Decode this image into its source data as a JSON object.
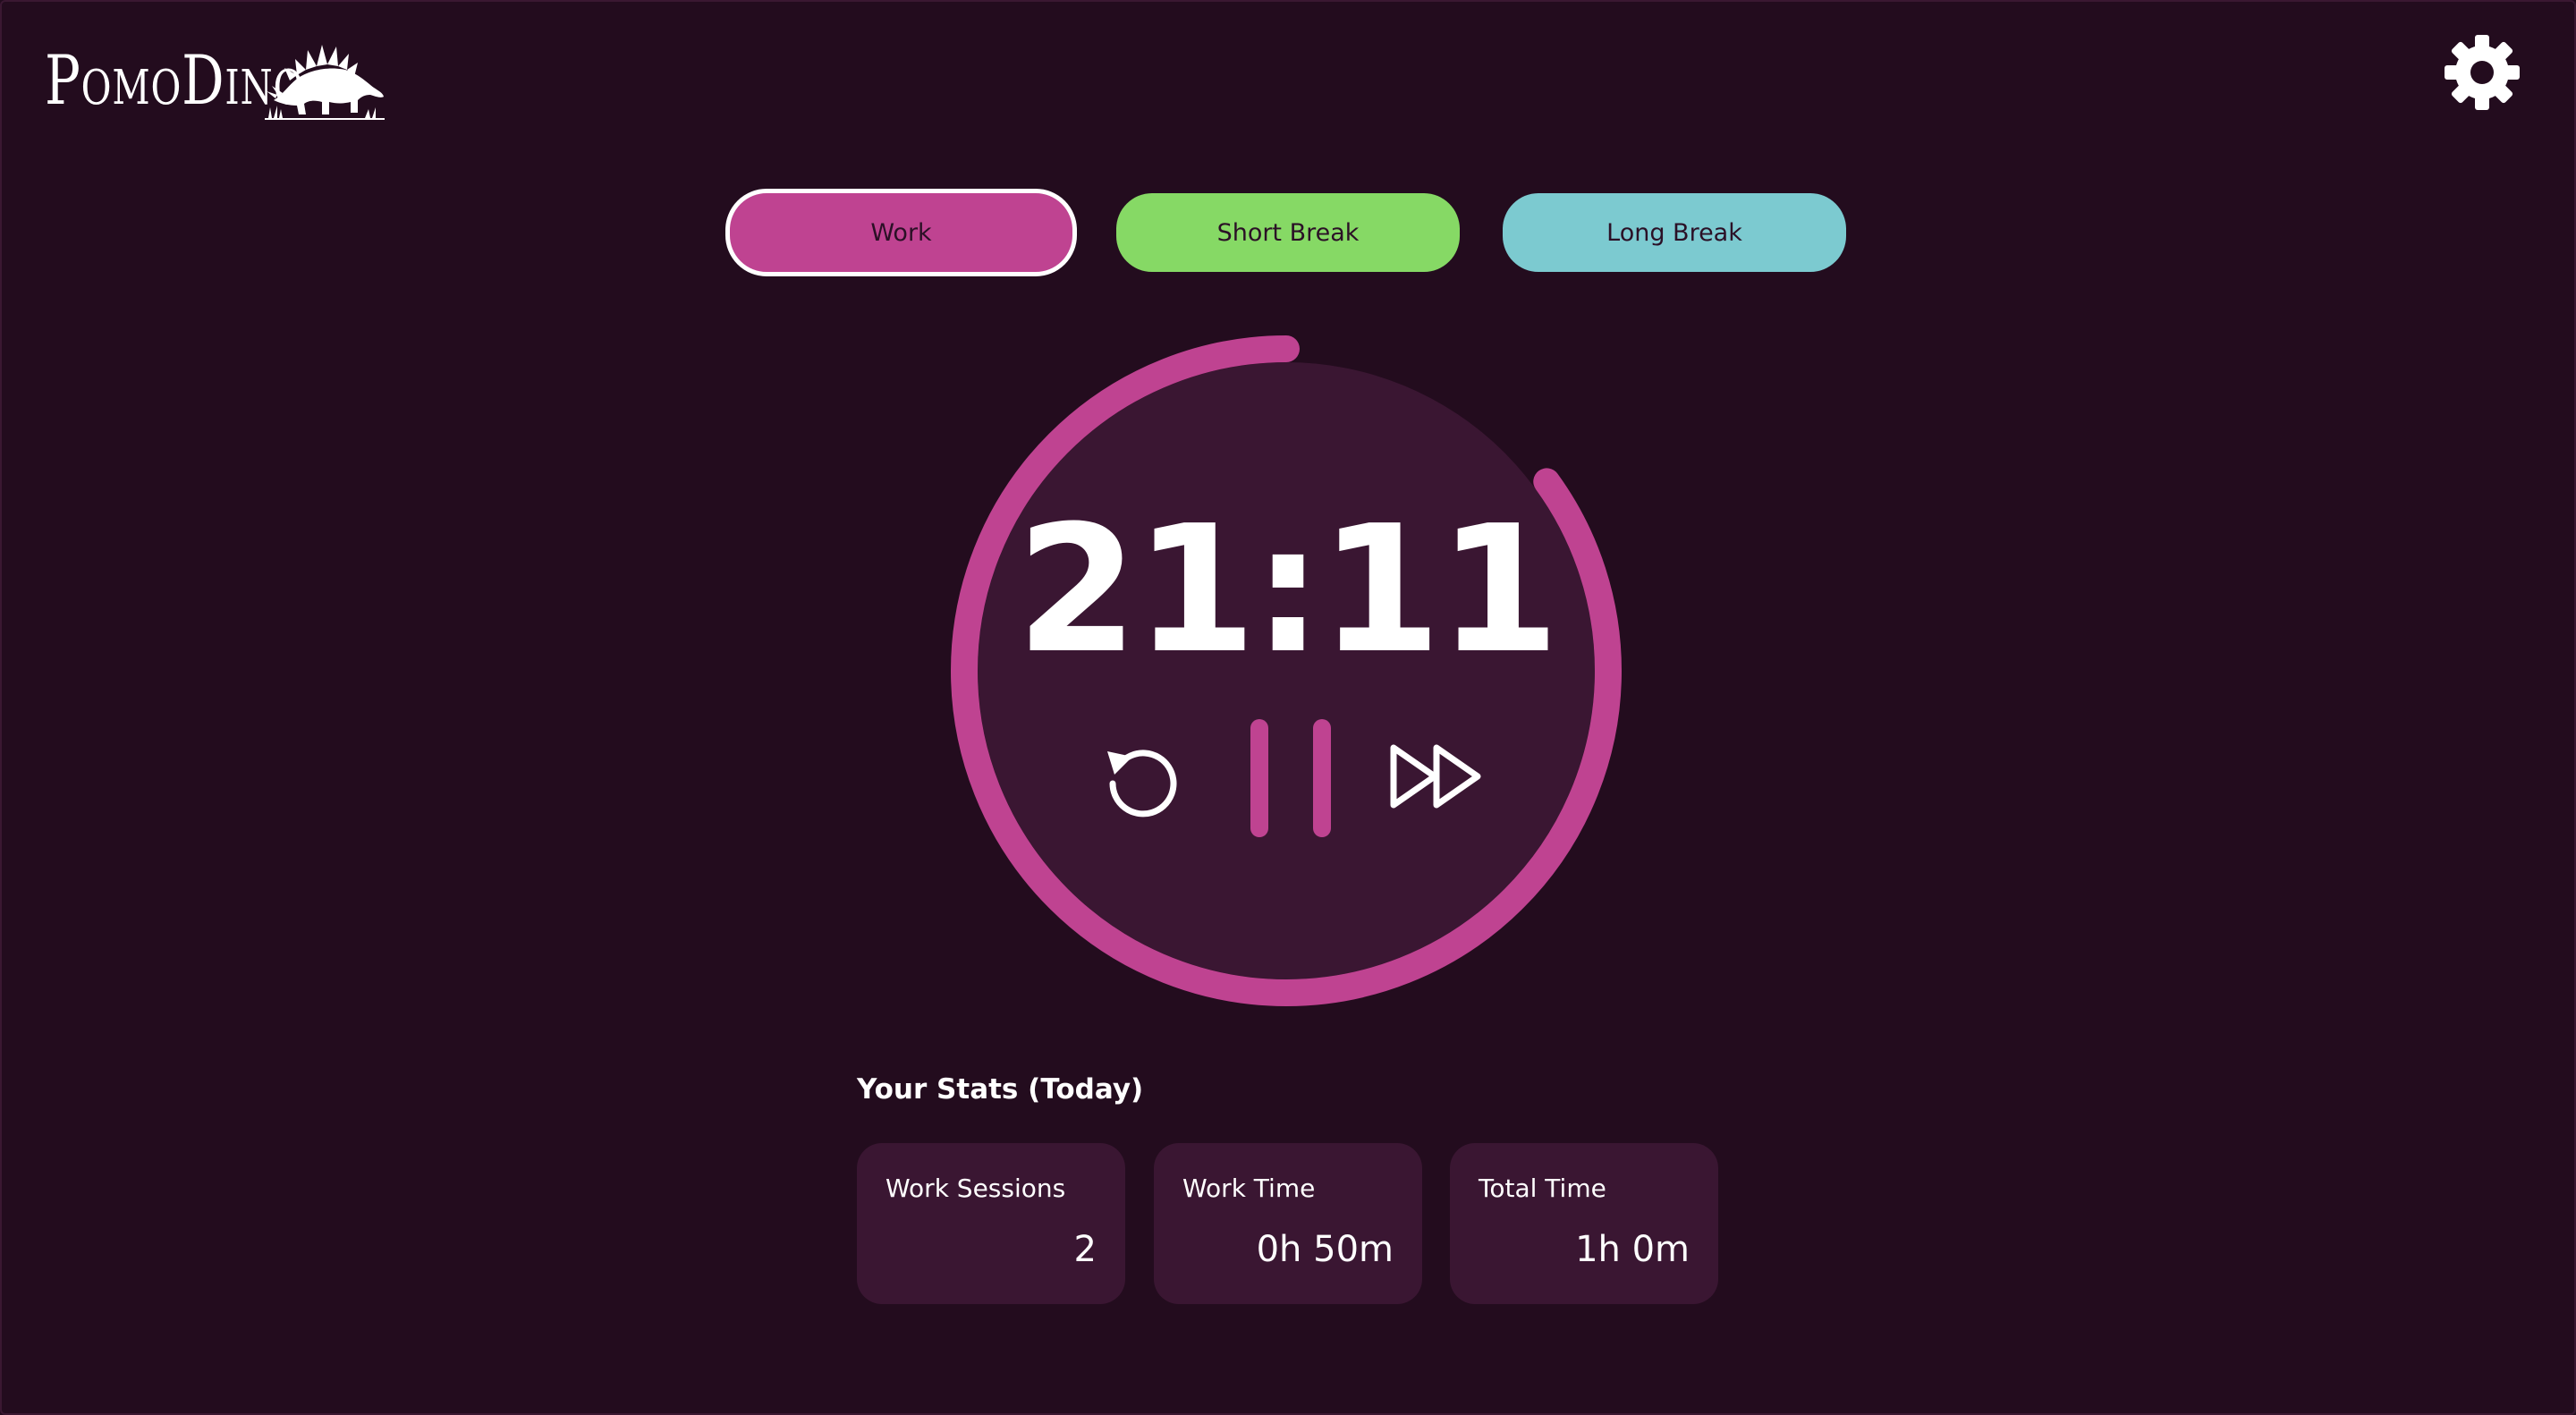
{
  "app": {
    "name": "PomoDino"
  },
  "modes": {
    "work": "Work",
    "short_break": "Short Break",
    "long_break": "Long Break",
    "active": "Work"
  },
  "timer": {
    "time": "21:11",
    "progress_remaining_fraction": 0.85,
    "state": "running"
  },
  "stats": {
    "title": "Your Stats (Today)",
    "cards": [
      {
        "label": "Work Sessions",
        "value": "2"
      },
      {
        "label": "Work Time",
        "value": "0h 50m"
      },
      {
        "label": "Total Time",
        "value": "1h 0m"
      }
    ]
  },
  "colors": {
    "background": "#230c1e",
    "card": "#3a1632",
    "work": "#bf4391",
    "short_break": "#86d965",
    "long_break": "#7ccad0",
    "text": "#ffffff"
  },
  "icons": {
    "settings": "gear-icon",
    "reset": "reset-icon",
    "pause": "pause-icon",
    "skip": "fast-forward-icon",
    "logo": "stegosaurus-icon"
  }
}
